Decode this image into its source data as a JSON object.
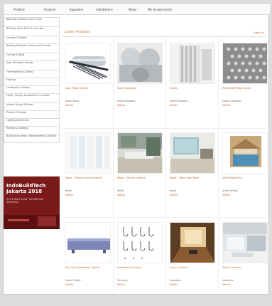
{
  "nav": {
    "items": [
      "Product",
      "Projects",
      "Suppliers",
      "Exhibitions",
      "News",
      "My Assignments"
    ]
  },
  "sidebar": {
    "categories": [
      "Bathroom, Kitchen Care & Tiles",
      "Building, Stone Brick & Concrete",
      "Carpets & Textiles",
      "Building Materials, Stone and Concrete",
      "Ceilings & Walls",
      "Door, Window & Facade",
      "Fire Protection & Safety",
      "Flooring",
      "Landscape & Garden",
      "Lights, Lamps, Accessories & Controls",
      "Interior Design & Decor",
      "Plastics & Rubber",
      "Lighting & Electrical",
      "Roofing & Cladding",
      "Building Insulation, Waterproofing & Sealing"
    ]
  },
  "ad": {
    "title": "IndoBuildTech Jakarta 2018",
    "sub": "21-25 March 2018 · ICE BSD City, Tangerang"
  },
  "section": {
    "title": "Latest Products",
    "more": "View all"
  },
  "products": [
    {
      "name": "Solar Water Heater",
      "location": "South Korea",
      "link": "Details"
    },
    {
      "name": "Stone Rockwool",
      "location": "United Kingdom",
      "link": "Details"
    },
    {
      "name": "Panels",
      "location": "United Kingdom",
      "link": "Details"
    },
    {
      "name": "Perforated Metal Panels",
      "location": "Pacific Gateways",
      "link": "Details"
    },
    {
      "name": "Wood - Pendant Ceiling Panels",
      "location": "Nepal",
      "link": "Details"
    },
    {
      "name": "Wood - Kitchen Cabinet",
      "location": "Nepal",
      "link": "Details"
    },
    {
      "name": "Wood - Decor Wall Panel",
      "location": "Nepal",
      "link": "Details"
    },
    {
      "name": "Steel Pergola Kit",
      "location": "United States",
      "link": "Details"
    },
    {
      "name": "Pipe Duct Ventilation System",
      "location": "United States",
      "link": "Details"
    },
    {
      "name": "Architectural Hooks",
      "location": "Germany",
      "link": "Details"
    },
    {
      "name": "Luxury Interior",
      "location": "Indonesia",
      "link": "Details"
    },
    {
      "name": "Kitchen Interior",
      "location": "Indonesia",
      "link": "Details"
    }
  ]
}
